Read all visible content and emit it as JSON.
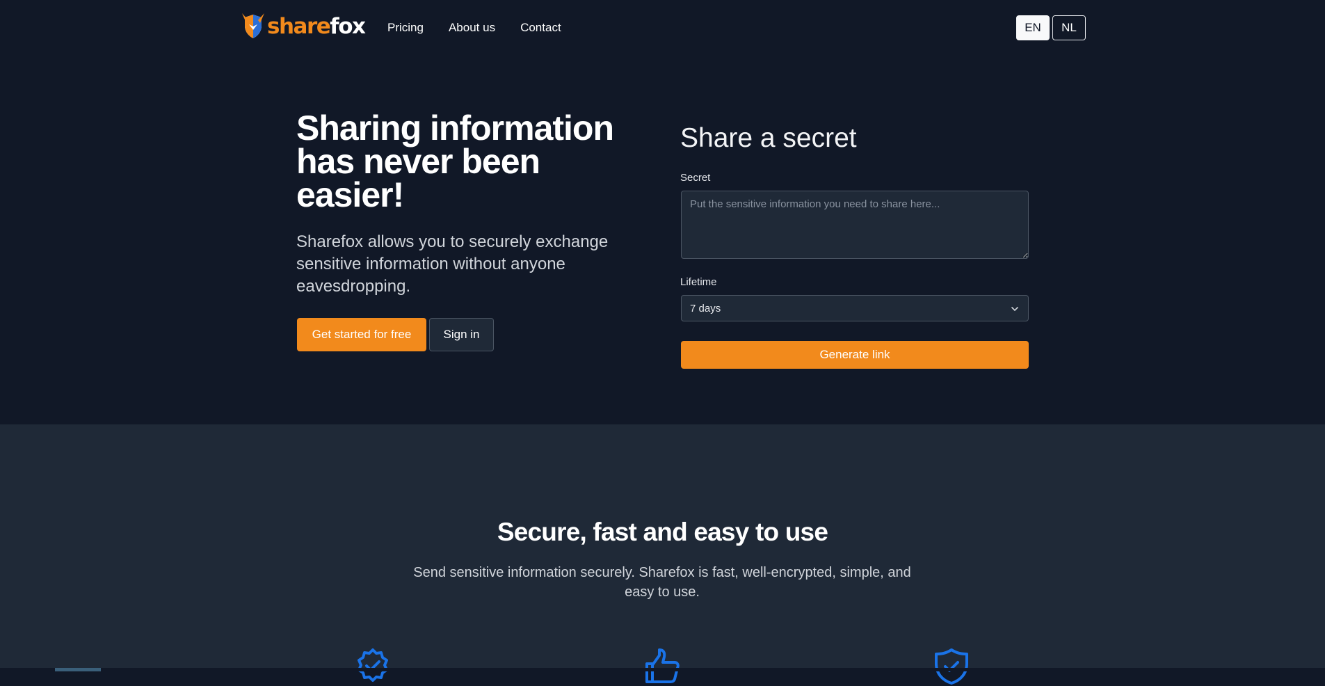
{
  "nav": {
    "logo_part1": "share",
    "logo_part2": "fox",
    "links": [
      "Pricing",
      "About us",
      "Contact"
    ],
    "languages": [
      "EN",
      "NL"
    ],
    "active_language": "EN"
  },
  "hero": {
    "title_lines": [
      "Sharing information",
      "has never been",
      "easier!"
    ],
    "subtitle_lines": [
      "Sharefox allows you to securely exchange",
      "sensitive information without anyone",
      "eavesdropping."
    ],
    "primary_button": "Get started for free",
    "secondary_button": "Sign in"
  },
  "form": {
    "title": "Share a secret",
    "secret_label": "Secret",
    "secret_placeholder": "Put the sensitive information you need to share here...",
    "lifetime_label": "Lifetime",
    "lifetime_value": "7 days",
    "submit": "Generate link"
  },
  "features": {
    "title": "Secure, fast and easy to use",
    "subtitle_lines": [
      "Send sensitive information securely. Sharefox is fast, well-encrypted, simple, and",
      "easy to use."
    ],
    "icons": [
      "badge-check-icon",
      "thumb-up-icon",
      "shield-check-icon"
    ]
  },
  "colors": {
    "brand": "#f28a1c",
    "background": "#111827",
    "section": "#1f2937",
    "icon_blue": "#1a73e8"
  }
}
